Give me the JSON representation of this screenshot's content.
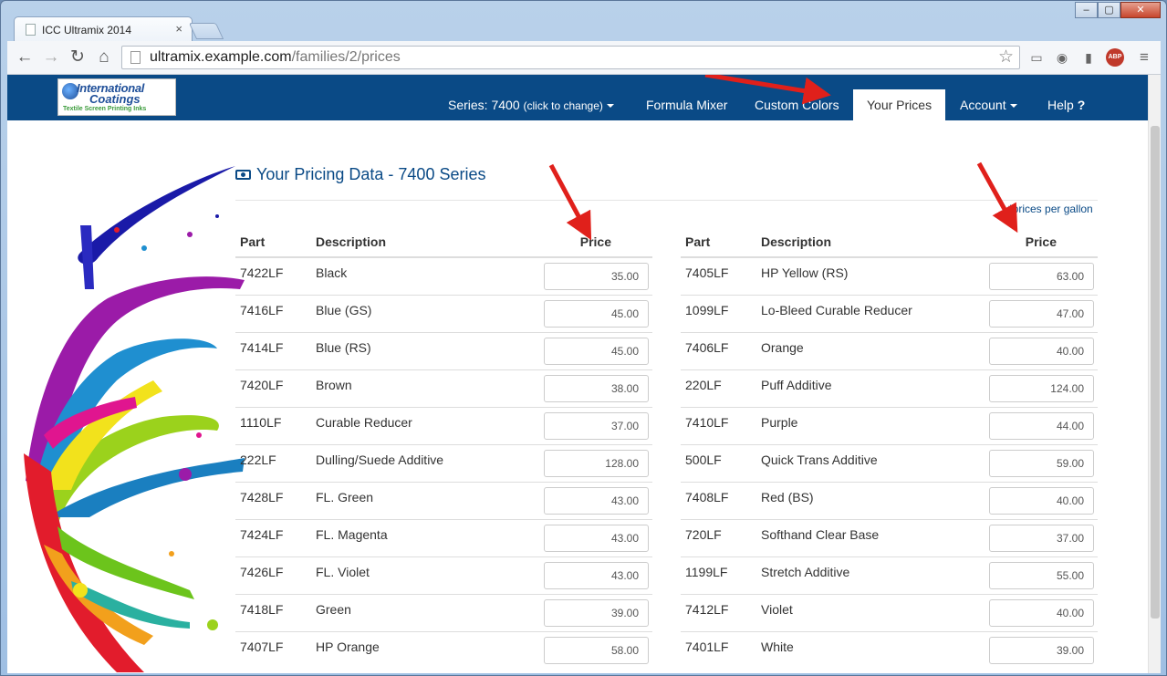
{
  "browser": {
    "tab_title": "ICC Ultramix 2014",
    "tab_close": "×",
    "url_host": "ultramix.example.com",
    "url_path": "/families/2/prices",
    "window_buttons": [
      "–",
      "▢",
      "✕"
    ],
    "abp_label": "ABP"
  },
  "navbar": {
    "logo": {
      "line1": "International",
      "line2": "Coatings",
      "tagline": "Textile Screen Printing Inks"
    },
    "series_label": "Series: 7400",
    "series_hint": "(click to change)",
    "formula_mixer": "Formula Mixer",
    "custom_colors": "Custom Colors",
    "your_prices": "Your Prices",
    "account": "Account",
    "help": "Help",
    "help_icon": "?"
  },
  "page": {
    "title": "Your Pricing Data - 7400 Series",
    "note": "*prices per gallon",
    "columns": {
      "part": "Part",
      "description": "Description",
      "price": "Price"
    }
  },
  "left_rows": [
    {
      "part": "7422LF",
      "description": "Black",
      "price": "35.00"
    },
    {
      "part": "7416LF",
      "description": "Blue (GS)",
      "price": "45.00"
    },
    {
      "part": "7414LF",
      "description": "Blue (RS)",
      "price": "45.00"
    },
    {
      "part": "7420LF",
      "description": "Brown",
      "price": "38.00"
    },
    {
      "part": "1110LF",
      "description": "Curable Reducer",
      "price": "37.00"
    },
    {
      "part": "222LF",
      "description": "Dulling/Suede Additive",
      "price": "128.00"
    },
    {
      "part": "7428LF",
      "description": "FL. Green",
      "price": "43.00"
    },
    {
      "part": "7424LF",
      "description": "FL. Magenta",
      "price": "43.00"
    },
    {
      "part": "7426LF",
      "description": "FL. Violet",
      "price": "43.00"
    },
    {
      "part": "7418LF",
      "description": "Green",
      "price": "39.00"
    },
    {
      "part": "7407LF",
      "description": "HP Orange",
      "price": "58.00"
    }
  ],
  "right_rows": [
    {
      "part": "7405LF",
      "description": "HP Yellow (RS)",
      "price": "63.00"
    },
    {
      "part": "1099LF",
      "description": "Lo-Bleed Curable Reducer",
      "price": "47.00"
    },
    {
      "part": "7406LF",
      "description": "Orange",
      "price": "40.00"
    },
    {
      "part": "220LF",
      "description": "Puff Additive",
      "price": "124.00"
    },
    {
      "part": "7410LF",
      "description": "Purple",
      "price": "44.00"
    },
    {
      "part": "500LF",
      "description": "Quick Trans Additive",
      "price": "59.00"
    },
    {
      "part": "7408LF",
      "description": "Red (BS)",
      "price": "40.00"
    },
    {
      "part": "720LF",
      "description": "Softhand Clear Base",
      "price": "37.00"
    },
    {
      "part": "1199LF",
      "description": "Stretch Additive",
      "price": "55.00"
    },
    {
      "part": "7412LF",
      "description": "Violet",
      "price": "40.00"
    },
    {
      "part": "7401LF",
      "description": "White",
      "price": "39.00"
    }
  ],
  "colors": {
    "navbar": "#0a4a86",
    "annotation_arrow": "#e0201b"
  }
}
